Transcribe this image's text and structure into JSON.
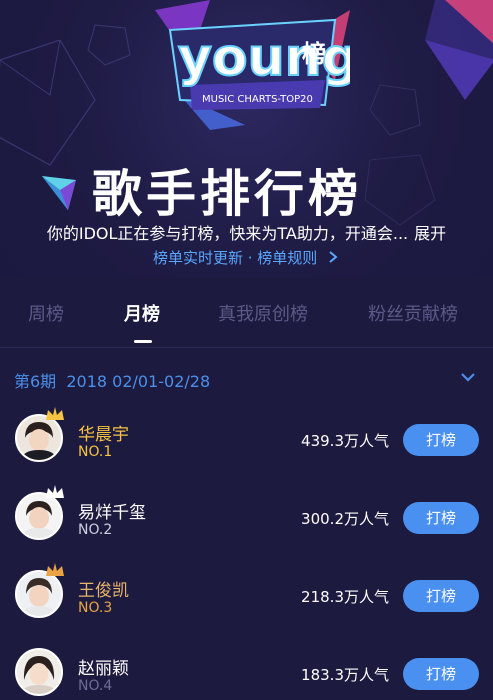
{
  "header": {
    "logo_word": "young",
    "logo_suffix": "榜",
    "logo_sub": "MUSIC CHARTS-TOP20",
    "title": "歌手排行榜",
    "intro": "你的IDOL正在参与打榜，快来为TA助力，开通会...",
    "expand": "展开",
    "rules_link": "榜单实时更新 · 榜单规则",
    "accent": "#5aa7ff"
  },
  "tabs": [
    {
      "label": "周榜",
      "active": false
    },
    {
      "label": "月榜",
      "active": true
    },
    {
      "label": "真我原创榜",
      "active": false
    },
    {
      "label": "粉丝贡献榜",
      "active": false
    }
  ],
  "period": {
    "label": "第6期  2018 02/01-02/28",
    "icon": "chevron-down-icon"
  },
  "list": [
    {
      "name": "华晨宇",
      "rank": "NO.1",
      "popularity": "439.3万人气",
      "button": "打榜"
    },
    {
      "name": "易烊千玺",
      "rank": "NO.2",
      "popularity": "300.2万人气",
      "button": "打榜"
    },
    {
      "name": "王俊凯",
      "rank": "NO.3",
      "popularity": "218.3万人气",
      "button": "打榜"
    },
    {
      "name": "赵丽颖",
      "rank": "NO.4",
      "popularity": "183.3万人气",
      "button": "打榜"
    }
  ],
  "colors": {
    "background": "#1d1a3f",
    "button": "#4a90f0",
    "gold": "#f6c342",
    "tab_inactive": "#5c5989"
  }
}
